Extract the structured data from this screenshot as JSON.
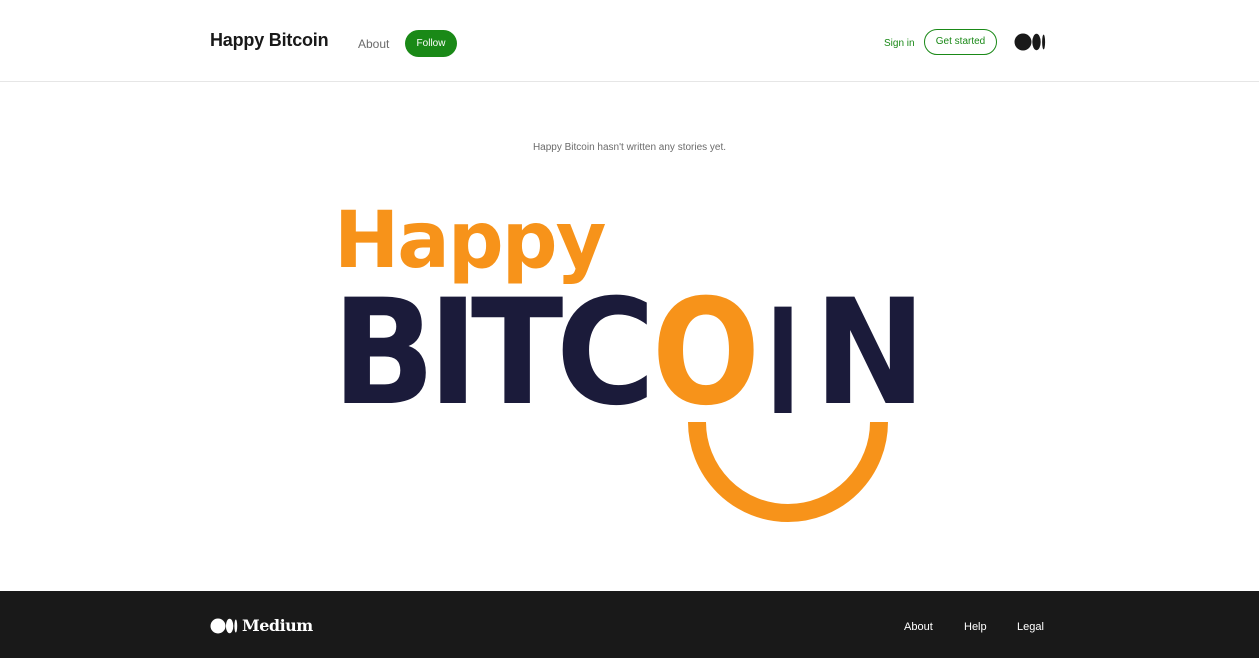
{
  "header": {
    "publication_title": "Happy Bitcoin",
    "about_label": "About",
    "follow_label": "Follow",
    "signin_label": "Sign in",
    "get_started_label": "Get started"
  },
  "main": {
    "empty_message": "Happy Bitcoin hasn't written any stories yet.",
    "logo": {
      "line1": "Happy",
      "line2_part1": "BITC",
      "line2_o": "O",
      "line2_i": "I",
      "line2_n": "N",
      "colors": {
        "orange": "#f7931a",
        "navy": "#1b1b3a"
      }
    }
  },
  "footer": {
    "brand_label": "Medium",
    "links": [
      "About",
      "Help",
      "Legal"
    ]
  },
  "colors": {
    "accent_green": "#1a8917",
    "footer_bg": "#191919"
  },
  "icons": {
    "medium_mark": "medium-logo-icon"
  }
}
